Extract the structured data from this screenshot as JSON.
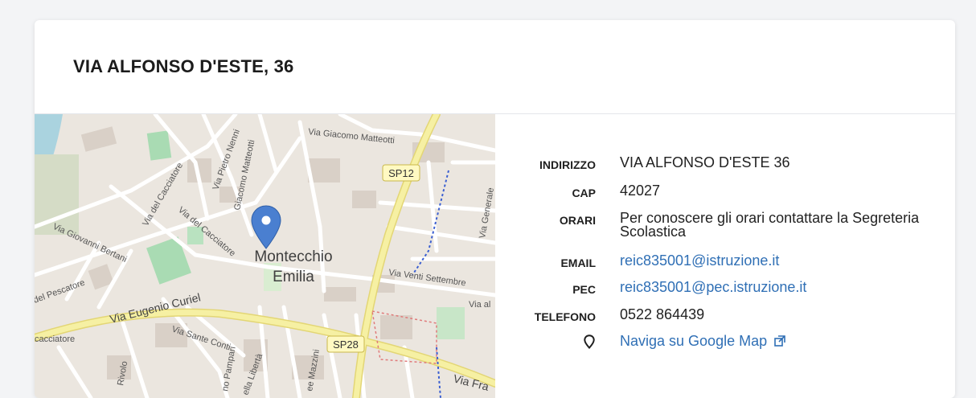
{
  "title": "VIA ALFONSO D'ESTE, 36",
  "map": {
    "labels": {
      "town_line1": "Montecchio",
      "town_line2": "Emilia",
      "sp12": "SP12",
      "sp28": "SP28",
      "via_eugenio_curiel": "Via Eugenio Curiel",
      "via_venti_settembre": "Via Venti Settembre",
      "via_giacomo_matteotti_top": "Via Giacomo Matteotti",
      "via_giacomo_matteotti_side": "Giacomo Matteotti",
      "via_pietro_nenni": "Via Pietro Nenni",
      "via_del_cacciatore_a": "Via del Cacciatore",
      "via_del_cacciatore_b": "Via del Cacciatore",
      "via_giovanni_bertani": "Via Giovanni Bertani",
      "via_del_pescatore": "del Pescatore",
      "via_sante_conti": "Via Sante Conti",
      "via_generale": "Via Generale",
      "via_fra": "Via Fra",
      "via_al": "Via al",
      "cacciatore_left": "cacciatore",
      "via_pampari": "no Pampari",
      "via_liberta": "ella Libertà",
      "via_mazzini": "ee Mazzini",
      "rivolo": "Rivolo"
    },
    "colors": {
      "pin": "#4a7fd0",
      "yellow_road": "#f6f0a3",
      "green_area": "#a9dbb3"
    }
  },
  "info": {
    "rows": [
      {
        "label": "INDIRIZZO",
        "value": "VIA ALFONSO D'ESTE 36"
      },
      {
        "label": "CAP",
        "value": "42027"
      },
      {
        "label": "ORARI",
        "value": "Per conoscere gli orari contattare la Segreteria Scolastica"
      },
      {
        "label": "EMAIL",
        "value": "reic835001@istruzione.it"
      },
      {
        "label": "PEC",
        "value": "reic835001@pec.istruzione.it"
      },
      {
        "label": "TELEFONO",
        "value": "0522 864439"
      }
    ],
    "maps_link": {
      "icon": "map-pin-icon",
      "label": "Naviga su Google Map",
      "external_icon": "external-link-icon"
    }
  },
  "link_color": "#2f6fb5"
}
